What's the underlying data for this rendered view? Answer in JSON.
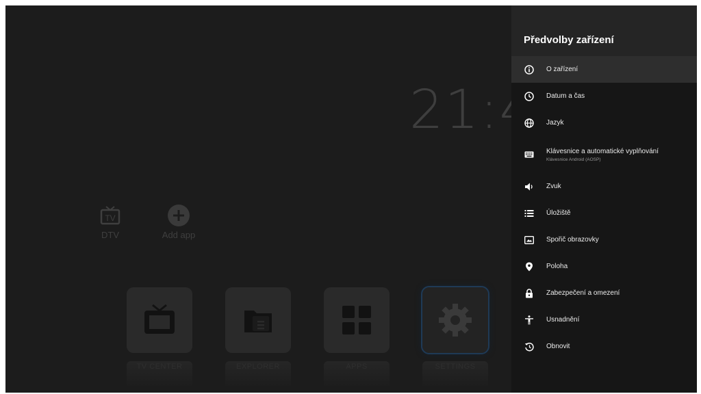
{
  "launcher": {
    "clock": "21:4",
    "small_apps": [
      {
        "label": "DTV",
        "icon": "tv-icon"
      },
      {
        "label": "Add app",
        "icon": "add-icon"
      }
    ],
    "tiles": [
      {
        "label": "TV CENTER",
        "icon": "tv-icon",
        "focused": false
      },
      {
        "label": "EXPLORER",
        "icon": "folder-icon",
        "focused": false
      },
      {
        "label": "APPS",
        "icon": "apps-grid-icon",
        "focused": false
      },
      {
        "label": "SETTINGS",
        "icon": "gear-icon",
        "focused": true
      }
    ]
  },
  "panel": {
    "title": "Předvolby zařízení",
    "items": [
      {
        "label": "O zařízení",
        "icon": "info-icon",
        "selected": true
      },
      {
        "label": "Datum a čas",
        "icon": "clock-icon"
      },
      {
        "label": "Jazyk",
        "icon": "globe-icon"
      },
      {
        "label": "Klávesnice a automatické vyplňování",
        "sublabel": "Klávesnice Android (AOSP)",
        "icon": "keyboard-icon"
      },
      {
        "label": "Zvuk",
        "icon": "speaker-icon"
      },
      {
        "label": "Úložiště",
        "icon": "storage-icon"
      },
      {
        "label": "Spořič obrazovky",
        "icon": "screensaver-icon"
      },
      {
        "label": "Poloha",
        "icon": "location-pin-icon"
      },
      {
        "label": "Zabezpečení a omezení",
        "icon": "lock-icon"
      },
      {
        "label": "Usnadnění",
        "icon": "accessibility-icon"
      },
      {
        "label": "Obnovit",
        "icon": "restore-icon"
      }
    ]
  }
}
